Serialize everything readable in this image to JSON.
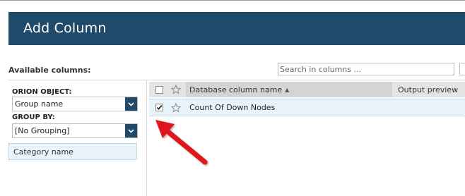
{
  "dialog": {
    "title": "Add Column"
  },
  "available": {
    "label": "Available columns:",
    "search_placeholder": "Search in columns ..."
  },
  "filters": {
    "orion_object_label": "ORION OBJECT:",
    "orion_object_value": "Group name",
    "group_by_label": "GROUP BY:",
    "group_by_value": "[No Grouping]",
    "category_item": "Category name"
  },
  "grid": {
    "columns": {
      "name": "Database column name",
      "preview": "Output preview"
    },
    "sort_indicator": "▲",
    "rows": [
      {
        "name": "Count Of Down Nodes",
        "checked": true,
        "starred": false
      }
    ]
  },
  "colors": {
    "title_bar": "#204a69",
    "selection_bg": "#e8f4fa",
    "annotation_arrow": "#e0141a"
  },
  "icons": {
    "header_checkbox": "checkbox-icon",
    "favorite": "star-icon",
    "dropdown": "chevron-down-icon",
    "annotation": "red-arrow-icon"
  }
}
